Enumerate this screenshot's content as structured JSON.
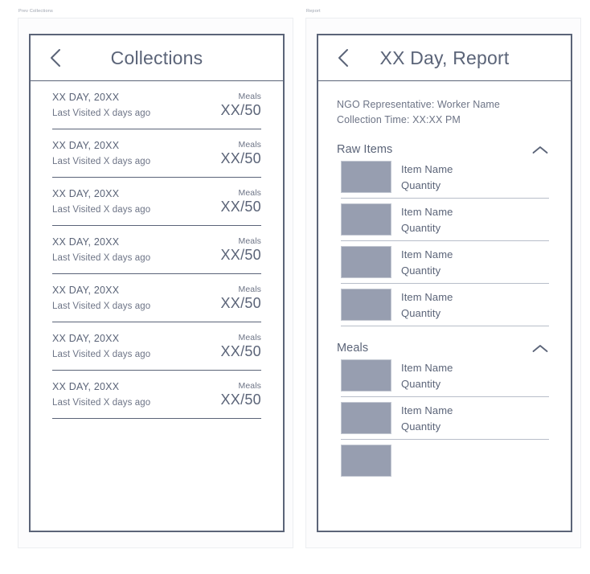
{
  "artboards": {
    "collections_label": "Prev Collections",
    "report_label": "Report"
  },
  "collections_screen": {
    "header": {
      "back_icon": "chevron-left-icon",
      "title": "Collections"
    },
    "rows": [
      {
        "date": "XX DAY, 20XX",
        "visited": "Last Visited X days ago",
        "meals_label": "Meals",
        "meals_count": "XX/50"
      },
      {
        "date": "XX DAY, 20XX",
        "visited": "Last Visited X days ago",
        "meals_label": "Meals",
        "meals_count": "XX/50"
      },
      {
        "date": "XX DAY, 20XX",
        "visited": "Last Visited X days ago",
        "meals_label": "Meals",
        "meals_count": "XX/50"
      },
      {
        "date": "XX DAY, 20XX",
        "visited": "Last Visited X days ago",
        "meals_label": "Meals",
        "meals_count": "XX/50"
      },
      {
        "date": "XX DAY, 20XX",
        "visited": "Last Visited X days ago",
        "meals_label": "Meals",
        "meals_count": "XX/50"
      },
      {
        "date": "XX DAY, 20XX",
        "visited": "Last Visited X days ago",
        "meals_label": "Meals",
        "meals_count": "XX/50"
      },
      {
        "date": "XX DAY, 20XX",
        "visited": "Last Visited X days ago",
        "meals_label": "Meals",
        "meals_count": "XX/50"
      }
    ]
  },
  "report_screen": {
    "header": {
      "back_icon": "chevron-left-icon",
      "title": "XX Day, Report"
    },
    "meta": {
      "representative": "NGO Representative: Worker Name",
      "collection_time": "Collection Time: XX:XX PM"
    },
    "sections": [
      {
        "title": "Raw Items",
        "collapse_icon": "chevron-up-icon",
        "items": [
          {
            "name": "Item Name",
            "quantity": "Quantity"
          },
          {
            "name": "Item Name",
            "quantity": "Quantity"
          },
          {
            "name": "Item Name",
            "quantity": "Quantity"
          },
          {
            "name": "Item Name",
            "quantity": "Quantity"
          }
        ]
      },
      {
        "title": "Meals",
        "collapse_icon": "chevron-up-icon",
        "items": [
          {
            "name": "Item Name",
            "quantity": "Quantity"
          },
          {
            "name": "Item Name",
            "quantity": "Quantity"
          },
          {
            "name": "",
            "quantity": ""
          }
        ]
      }
    ]
  },
  "colors": {
    "ink": "#5b6478",
    "muted": "#6d7486",
    "divider_strong": "#5b6478",
    "divider_light": "#b8bec9",
    "thumb": "#979eb0",
    "artboard_bg": "#fcfcfd",
    "artboard_border": "#eceef1"
  }
}
